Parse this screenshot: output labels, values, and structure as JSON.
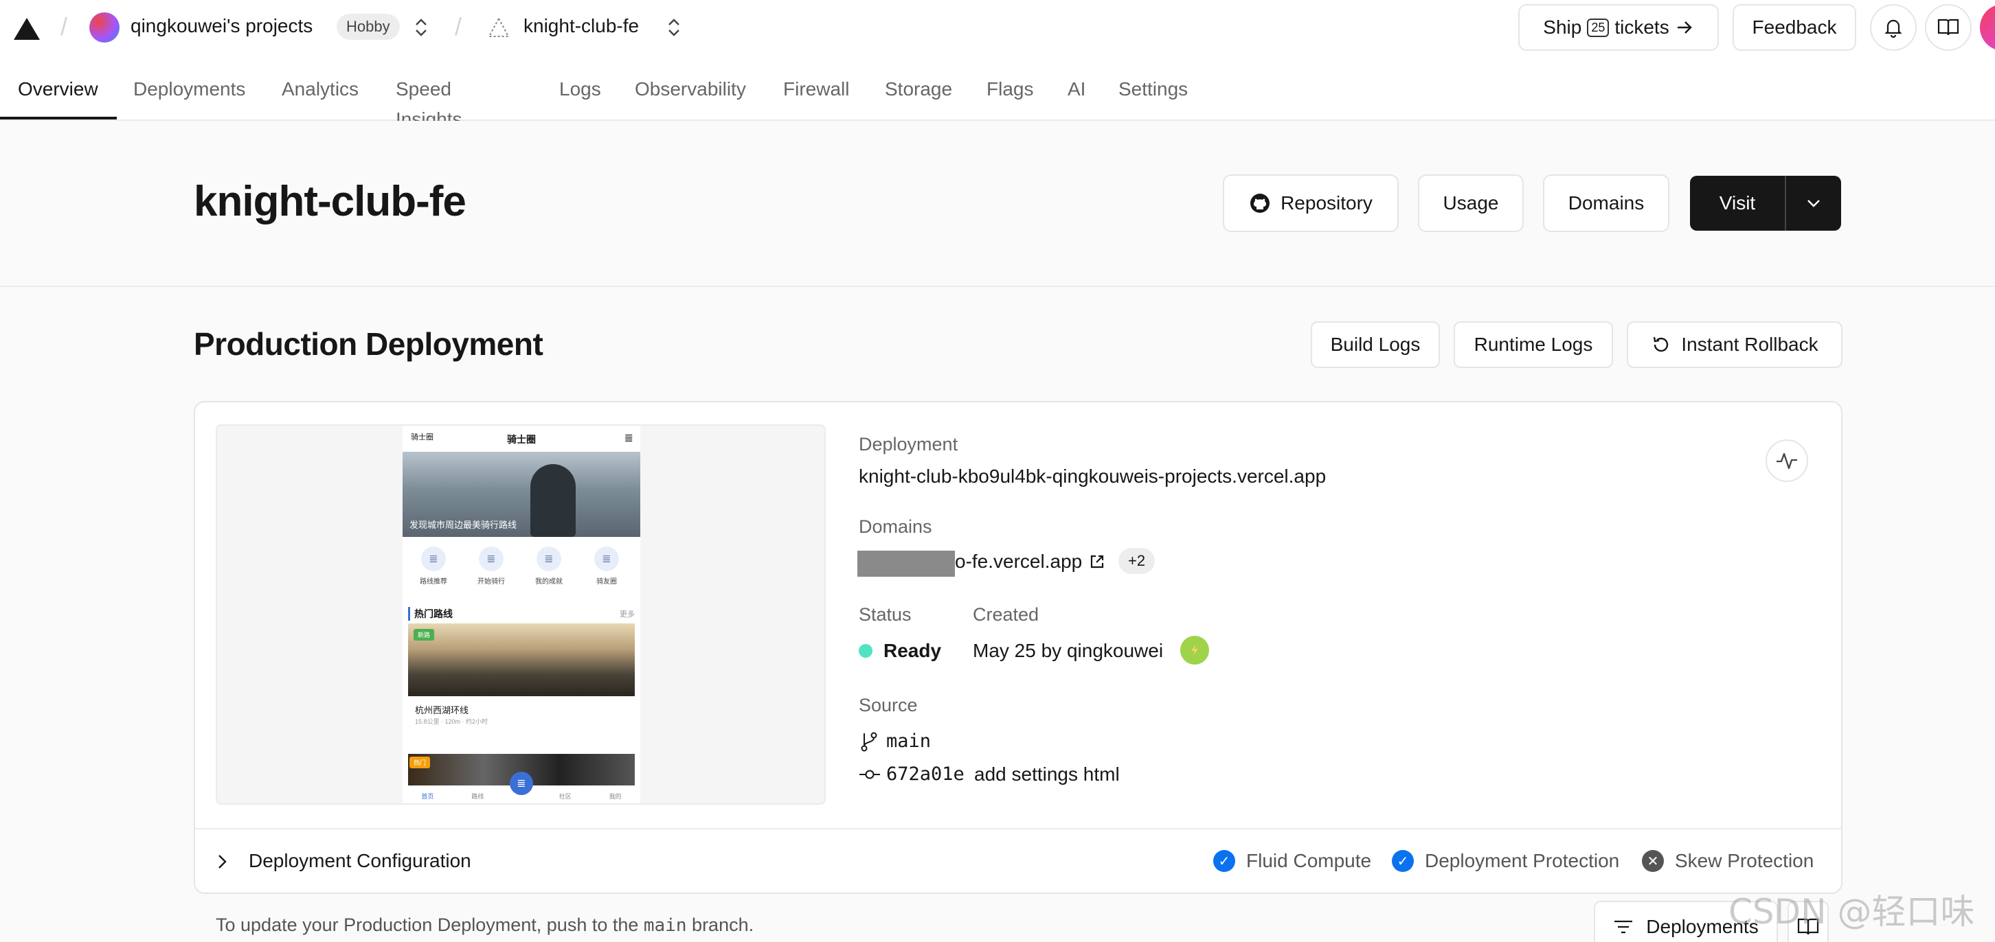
{
  "header": {
    "team_name": "qingkouwei's projects",
    "plan_badge": "Hobby",
    "project_name": "knight-club-fe",
    "ship_prefix": "Ship",
    "ship_count": "25",
    "ship_suffix": "tickets",
    "feedback_label": "Feedback"
  },
  "tabs": [
    {
      "label": "Overview"
    },
    {
      "label": "Deployments"
    },
    {
      "label": "Analytics"
    },
    {
      "label": "Speed Insights"
    },
    {
      "label": "Logs"
    },
    {
      "label": "Observability"
    },
    {
      "label": "Firewall"
    },
    {
      "label": "Storage"
    },
    {
      "label": "Flags"
    },
    {
      "label": "AI"
    },
    {
      "label": "Settings"
    }
  ],
  "project": {
    "title": "knight-club-fe",
    "repository_label": "Repository",
    "usage_label": "Usage",
    "domains_label": "Domains",
    "visit_label": "Visit"
  },
  "production": {
    "title": "Production Deployment",
    "build_logs_label": "Build Logs",
    "runtime_logs_label": "Runtime Logs",
    "rollback_label": "Instant Rollback",
    "deployment_label": "Deployment",
    "deployment_url": "knight-club-kbo9ul4bk-qingkouweis-projects.vercel.app",
    "domains_label": "Domains",
    "domain_value": "o-fe.vercel.app",
    "domains_more": "+2",
    "status_label": "Status",
    "status_value": "Ready",
    "created_label": "Created",
    "created_value": "May 25 by qingkouwei",
    "source_label": "Source",
    "branch": "main",
    "commit_hash": "672a01e",
    "commit_message": "add settings html",
    "config_label": "Deployment Configuration",
    "features": [
      {
        "label": "Fluid Compute",
        "enabled": true
      },
      {
        "label": "Deployment Protection",
        "enabled": true
      },
      {
        "label": "Skew Protection",
        "enabled": false
      }
    ]
  },
  "preview": {
    "app_logo_text": "骑士圈",
    "app_title": "骑士圈",
    "hero_caption": "发现城市周边最美骑行路线",
    "icons": [
      "路线推荐",
      "开始骑行",
      "我的成就",
      "骑友圈"
    ],
    "section_title": "热门路线",
    "section_more": "更多",
    "badge_green": "新路",
    "route_name": "杭州西湖环线",
    "route_meta": "15.8公里 · 120m · 约2小时",
    "badge_orange": "热门",
    "nav": [
      "首页",
      "路线",
      "",
      "社区",
      "我的"
    ]
  },
  "footer": {
    "text_prefix": "To update your Production Deployment, push to the",
    "branch": "main",
    "text_suffix": "branch.",
    "deployments_label": "Deployments"
  },
  "watermark": "CSDN @轻口味",
  "colors": {
    "ready": "#50e3c2",
    "check_blue": "#0a72ef",
    "visit_bg": "#171717"
  }
}
